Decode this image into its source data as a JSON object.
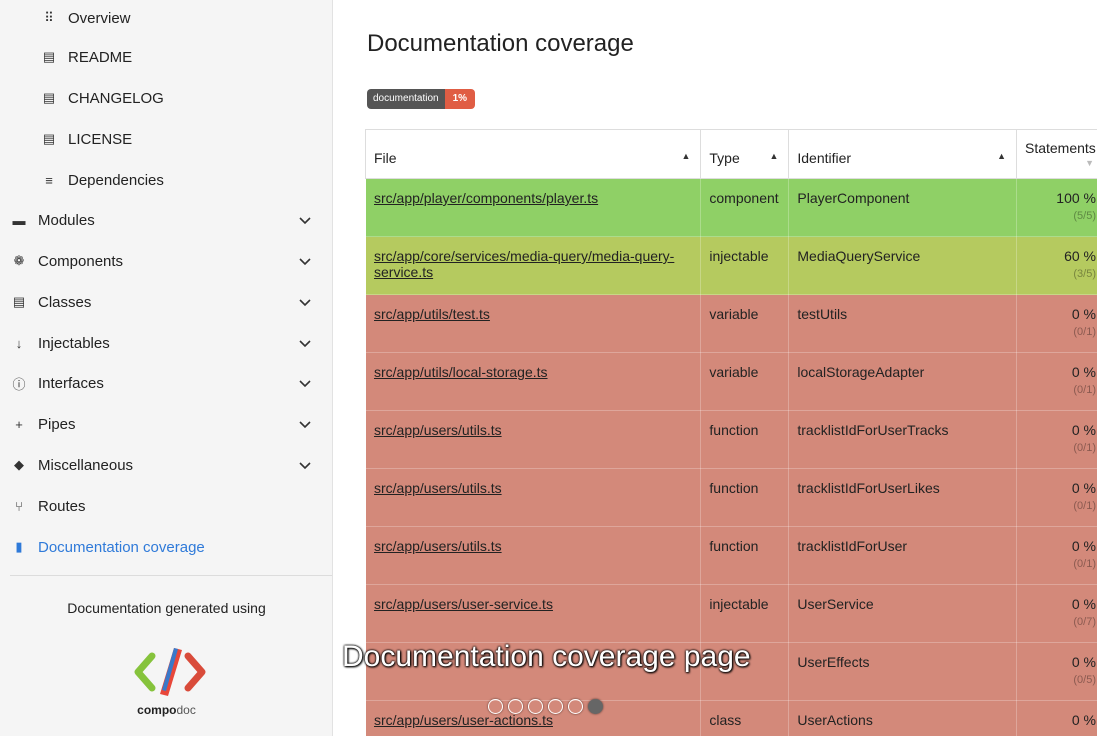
{
  "sidebar": {
    "items": [
      {
        "label": "Overview",
        "icon": "grid-icon",
        "glyph": "⠿"
      },
      {
        "label": "README",
        "icon": "book-icon",
        "glyph": "▤"
      },
      {
        "label": "CHANGELOG",
        "icon": "book-icon",
        "glyph": "▤"
      },
      {
        "label": "LICENSE",
        "icon": "book-icon",
        "glyph": "▤"
      },
      {
        "label": "Dependencies",
        "icon": "list-icon",
        "glyph": "≡"
      },
      {
        "label": "Modules",
        "icon": "archive-icon",
        "glyph": "▬"
      },
      {
        "label": "Components",
        "icon": "gear-icon",
        "glyph": "❁"
      },
      {
        "label": "Classes",
        "icon": "file-icon",
        "glyph": "▤"
      },
      {
        "label": "Injectables",
        "icon": "arrow-down-icon",
        "glyph": "↓"
      },
      {
        "label": "Interfaces",
        "icon": "info-icon",
        "glyph": "ⓘ"
      },
      {
        "label": "Pipes",
        "icon": "plus-icon",
        "glyph": "+"
      },
      {
        "label": "Miscellaneous",
        "icon": "cube-icon",
        "glyph": "◆"
      },
      {
        "label": "Routes",
        "icon": "branch-icon",
        "glyph": "⑂"
      },
      {
        "label": "Documentation coverage",
        "icon": "bar-chart-icon",
        "glyph": "▮"
      }
    ],
    "generated_text": "Documentation generated using",
    "logo_text_bold": "compo",
    "logo_text_light": "doc"
  },
  "main": {
    "title": "Documentation coverage",
    "badge": {
      "label": "documentation",
      "value": "1%"
    },
    "table": {
      "headers": {
        "file": "File",
        "type": "Type",
        "identifier": "Identifier",
        "statements": "Statements"
      },
      "rows": [
        {
          "file": "src/app/player/components/player.ts",
          "type": "component",
          "identifier": "PlayerComponent",
          "percent": "100 %",
          "fraction": "(5/5)"
        },
        {
          "file": "src/app/core/services/media-query/media-query-service.ts",
          "type": "injectable",
          "identifier": "MediaQueryService",
          "percent": "60 %",
          "fraction": "(3/5)"
        },
        {
          "file": "src/app/utils/test.ts",
          "type": "variable",
          "identifier": "testUtils",
          "percent": "0 %",
          "fraction": "(0/1)"
        },
        {
          "file": "src/app/utils/local-storage.ts",
          "type": "variable",
          "identifier": "localStorageAdapter",
          "percent": "0 %",
          "fraction": "(0/1)"
        },
        {
          "file": "src/app/users/utils.ts",
          "type": "function",
          "identifier": "tracklistIdForUserTracks",
          "percent": "0 %",
          "fraction": "(0/1)"
        },
        {
          "file": "src/app/users/utils.ts",
          "type": "function",
          "identifier": "tracklistIdForUserLikes",
          "percent": "0 %",
          "fraction": "(0/1)"
        },
        {
          "file": "src/app/users/utils.ts",
          "type": "function",
          "identifier": "tracklistIdForUser",
          "percent": "0 %",
          "fraction": "(0/1)"
        },
        {
          "file": "src/app/users/user-service.ts",
          "type": "injectable",
          "identifier": "UserService",
          "percent": "0 %",
          "fraction": "(0/7)"
        },
        {
          "file": "",
          "type": "",
          "identifier": "UserEffects",
          "percent": "0 %",
          "fraction": "(0/5)"
        },
        {
          "file": "src/app/users/user-actions.ts",
          "type": "class",
          "identifier": "UserActions",
          "percent": "0 %",
          "fraction": ""
        }
      ]
    }
  },
  "overlay": {
    "caption": "Documentation coverage page",
    "slides_total": 6,
    "active_slide": 6
  },
  "colors": {
    "good": "#8fd066",
    "mid": "#b5ca5f",
    "bad": "#d3897a",
    "active_link": "#2f7ad9",
    "badge_value": "#e05d44"
  }
}
